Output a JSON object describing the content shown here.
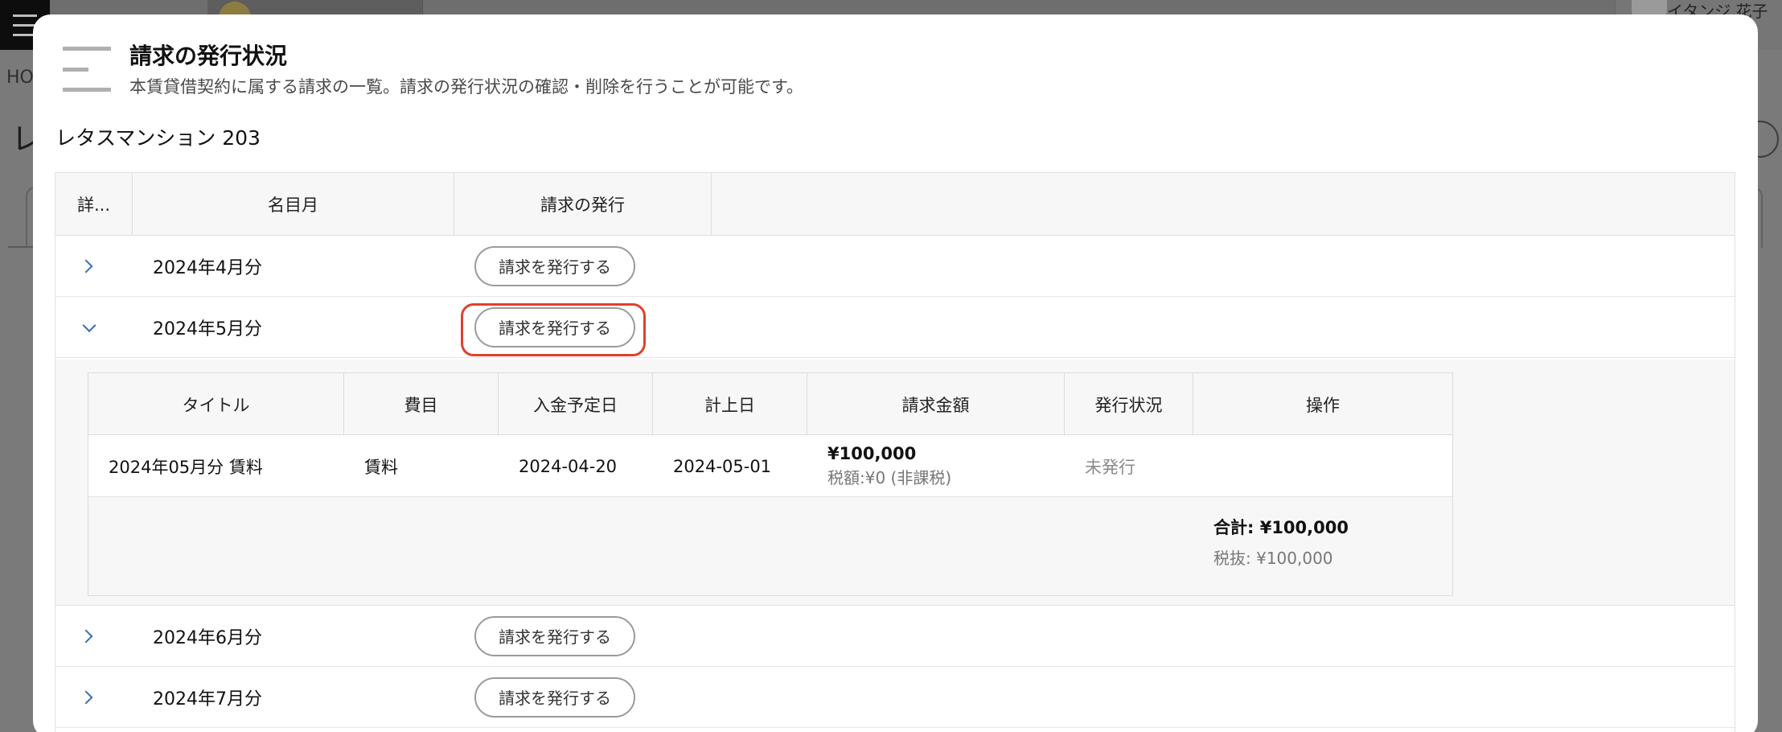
{
  "background": {
    "user_name": "イタンジ 花子",
    "breadcrumb": "HO",
    "page_title_initial": "レ"
  },
  "modal": {
    "title": "請求の発行状況",
    "description": "本賃貸借契約に属する請求の一覧。請求の発行状況の確認・削除を行うことが可能です。",
    "property": "レタスマンション 203",
    "highlight_color": "#e0412a"
  },
  "table": {
    "headers": [
      "詳...",
      "名目月",
      "請求の発行"
    ],
    "button_label": "請求を発行する",
    "rows": [
      {
        "month": "2024年4月分",
        "expanded": false
      },
      {
        "month": "2024年5月分",
        "expanded": true
      },
      {
        "month": "2024年6月分",
        "expanded": false
      },
      {
        "month": "2024年7月分",
        "expanded": false
      }
    ]
  },
  "detail": {
    "headers": [
      "タイトル",
      "費目",
      "入金予定日",
      "計上日",
      "請求金額",
      "発行状況",
      "操作"
    ],
    "row": {
      "title": "2024年05月分 賃料",
      "item": "賃料",
      "due_date": "2024-04-20",
      "record_date": "2024-05-01",
      "amount": "¥100,000",
      "tax": "税額:¥0 (非課税)",
      "status": "未発行",
      "action": ""
    },
    "total": "合計: ¥100,000",
    "total_ex_tax": "税抜: ¥100,000"
  }
}
